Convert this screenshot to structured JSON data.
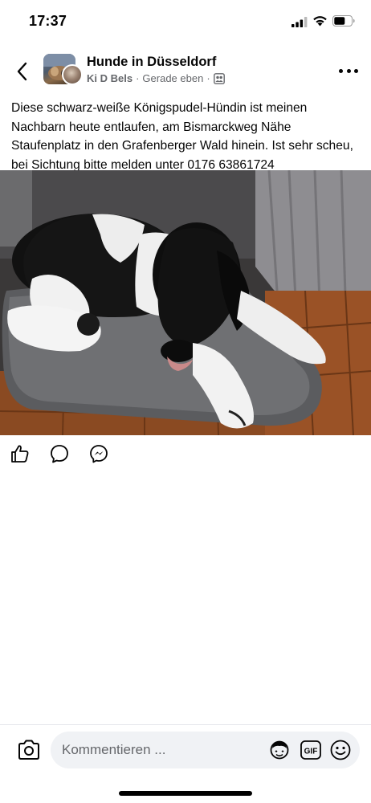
{
  "status_bar": {
    "time": "17:37",
    "icons": [
      "cellular-signal-icon",
      "wifi-icon",
      "battery-icon"
    ]
  },
  "header": {
    "back_icon": "chevron-left-icon",
    "group_name": "Hunde in Düsseldorf",
    "author": "Ki D Bels",
    "separator": "·",
    "timestamp": "Gerade eben",
    "audience_icon": "group-members-icon",
    "more_icon": "more-horizontal-icon"
  },
  "post": {
    "text": "Diese schwarz-weiße Königspudel-Hündin ist meinen Nachbarn heute entlaufen, am Bismarckweg Nähe Staufenplatz in den Grafenberger Wald hinein. Ist sehr scheu, bei Sichtung bitte melden unter 0176 63861724",
    "image_alt": "Schwarz-weiße Königspudel-Hündin auf einem grauen Hundekissen"
  },
  "actions": {
    "icons": [
      "like-icon",
      "comment-icon",
      "messenger-share-icon"
    ]
  },
  "comment_bar": {
    "placeholder": "Kommentieren ...",
    "icons": [
      "camera-icon",
      "avatar-sticker-icon",
      "gif-icon",
      "emoji-icon"
    ],
    "gif_label": "GIF"
  },
  "colors": {
    "text_primary": "#050505",
    "text_secondary": "#65676b",
    "input_bg": "#f0f2f5"
  }
}
